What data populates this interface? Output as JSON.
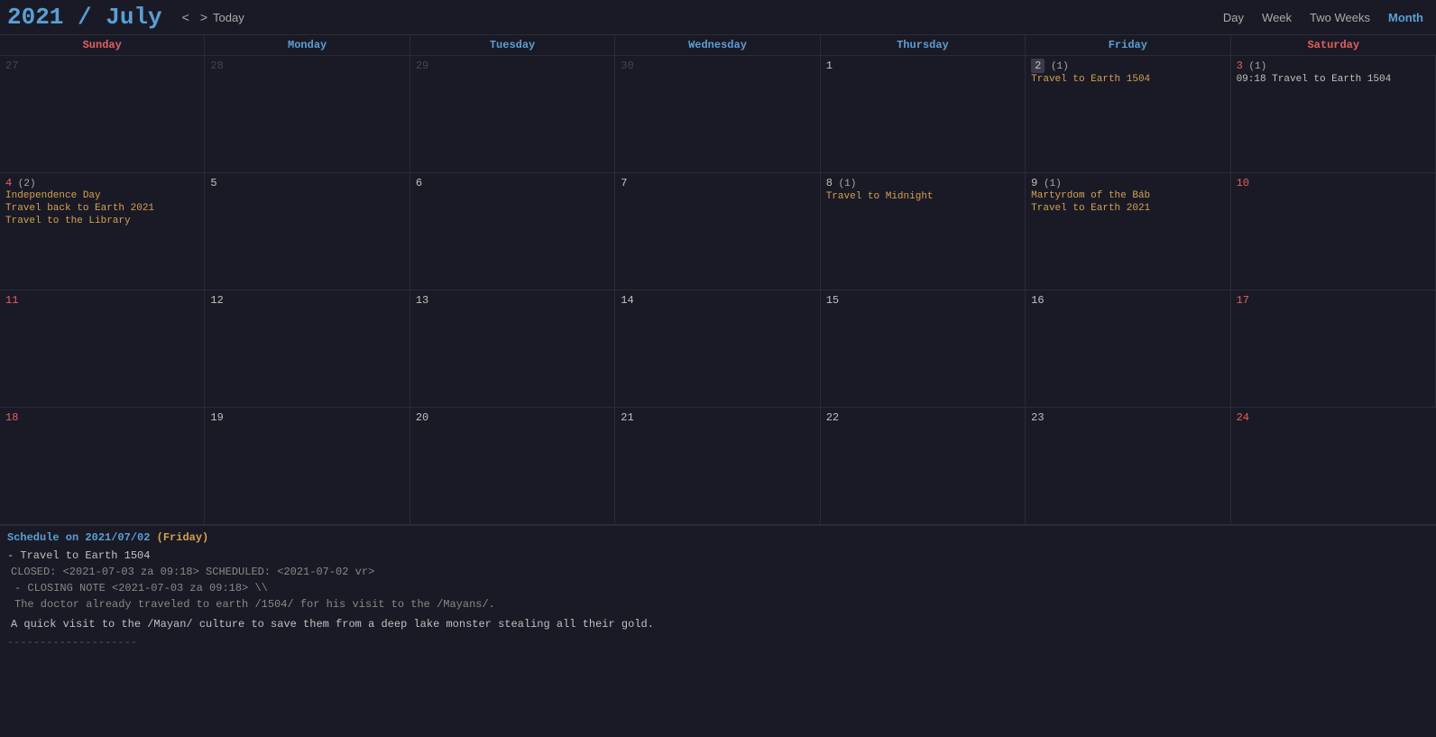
{
  "header": {
    "year": "2021",
    "slash": "/",
    "month_name": "July",
    "nav_prev": "<",
    "nav_next": ">",
    "nav_today": "Today",
    "views": [
      "Day",
      "Week",
      "Two Weeks",
      "Month"
    ],
    "active_view": "Month"
  },
  "day_headers": [
    {
      "label": "Sunday",
      "class": "sunday"
    },
    {
      "label": "Monday",
      "class": "monday"
    },
    {
      "label": "Tuesday",
      "class": "tuesday"
    },
    {
      "label": "Wednesday",
      "class": "wednesday"
    },
    {
      "label": "Thursday",
      "class": "thursday"
    },
    {
      "label": "Friday",
      "class": "friday"
    },
    {
      "label": "Saturday",
      "class": "saturday"
    }
  ],
  "weeks": [
    {
      "days": [
        {
          "day": "27",
          "other": true,
          "col": "sunday"
        },
        {
          "day": "28",
          "other": true,
          "col": "monday"
        },
        {
          "day": "29",
          "other": true,
          "col": "tuesday"
        },
        {
          "day": "30",
          "other": true,
          "col": "wednesday"
        },
        {
          "day": "1",
          "other": false,
          "col": "thursday",
          "events": []
        },
        {
          "day": "2",
          "other": false,
          "col": "friday",
          "badge": "(1)",
          "highlighted": true,
          "events": [
            {
              "text": "Travel to Earth 1504",
              "cls": "orange"
            }
          ]
        },
        {
          "day": "3",
          "other": false,
          "col": "saturday",
          "badge": "(1)",
          "events": [
            {
              "text": "09:18 Travel to Earth 1504",
              "cls": "gray"
            }
          ]
        }
      ]
    },
    {
      "days": [
        {
          "day": "4",
          "other": false,
          "col": "sunday",
          "badge": "(2)",
          "holiday": "Independence Day",
          "events": [
            {
              "text": "Travel back to Earth 2021",
              "cls": "orange"
            },
            {
              "text": "Travel to the Library",
              "cls": "orange"
            }
          ]
        },
        {
          "day": "5",
          "other": false,
          "col": "monday",
          "events": []
        },
        {
          "day": "6",
          "other": false,
          "col": "tuesday",
          "events": []
        },
        {
          "day": "7",
          "other": false,
          "col": "wednesday",
          "events": []
        },
        {
          "day": "8",
          "other": false,
          "col": "thursday",
          "badge": "(1)",
          "events": [
            {
              "text": "Travel to Midnight",
              "cls": "orange"
            }
          ]
        },
        {
          "day": "9",
          "other": false,
          "col": "friday",
          "badge": "(1)",
          "holiday": "Martyrdom of the Báb",
          "events": [
            {
              "text": "Travel to Earth 2021",
              "cls": "orange"
            }
          ]
        },
        {
          "day": "10",
          "other": false,
          "col": "saturday",
          "events": []
        }
      ]
    },
    {
      "days": [
        {
          "day": "11",
          "other": false,
          "col": "sunday",
          "events": []
        },
        {
          "day": "12",
          "other": false,
          "col": "monday",
          "events": []
        },
        {
          "day": "13",
          "other": false,
          "col": "tuesday",
          "events": []
        },
        {
          "day": "14",
          "other": false,
          "col": "wednesday",
          "events": []
        },
        {
          "day": "15",
          "other": false,
          "col": "thursday",
          "events": []
        },
        {
          "day": "16",
          "other": false,
          "col": "friday",
          "events": []
        },
        {
          "day": "17",
          "other": false,
          "col": "saturday",
          "events": []
        }
      ]
    },
    {
      "days": [
        {
          "day": "18",
          "other": false,
          "col": "sunday",
          "events": []
        },
        {
          "day": "19",
          "other": false,
          "col": "monday",
          "events": []
        },
        {
          "day": "20",
          "other": false,
          "col": "tuesday",
          "events": []
        },
        {
          "day": "21",
          "other": false,
          "col": "wednesday",
          "events": []
        },
        {
          "day": "22",
          "other": false,
          "col": "thursday",
          "events": []
        },
        {
          "day": "23",
          "other": false,
          "col": "friday",
          "events": []
        },
        {
          "day": "24",
          "other": false,
          "col": "saturday",
          "events": []
        }
      ]
    }
  ],
  "schedule": {
    "title": "Schedule on 2021/07/02",
    "title_paren": "(Friday)",
    "items": [
      {
        "label": "- Travel to Earth 1504",
        "meta": "CLOSED: <2021-07-03 za 09:18> SCHEDULED: <2021-07-02 vr>",
        "notes": [
          "- CLOSING NOTE <2021-07-03 za 09:18> \\\\",
          "  The doctor already traveled to earth /1504/ for his visit to the /Mayans/."
        ],
        "desc": "A quick visit to the /Mayan/ culture to save them from a deep lake monster stealing all their gold."
      }
    ],
    "divider": "--------------------"
  }
}
